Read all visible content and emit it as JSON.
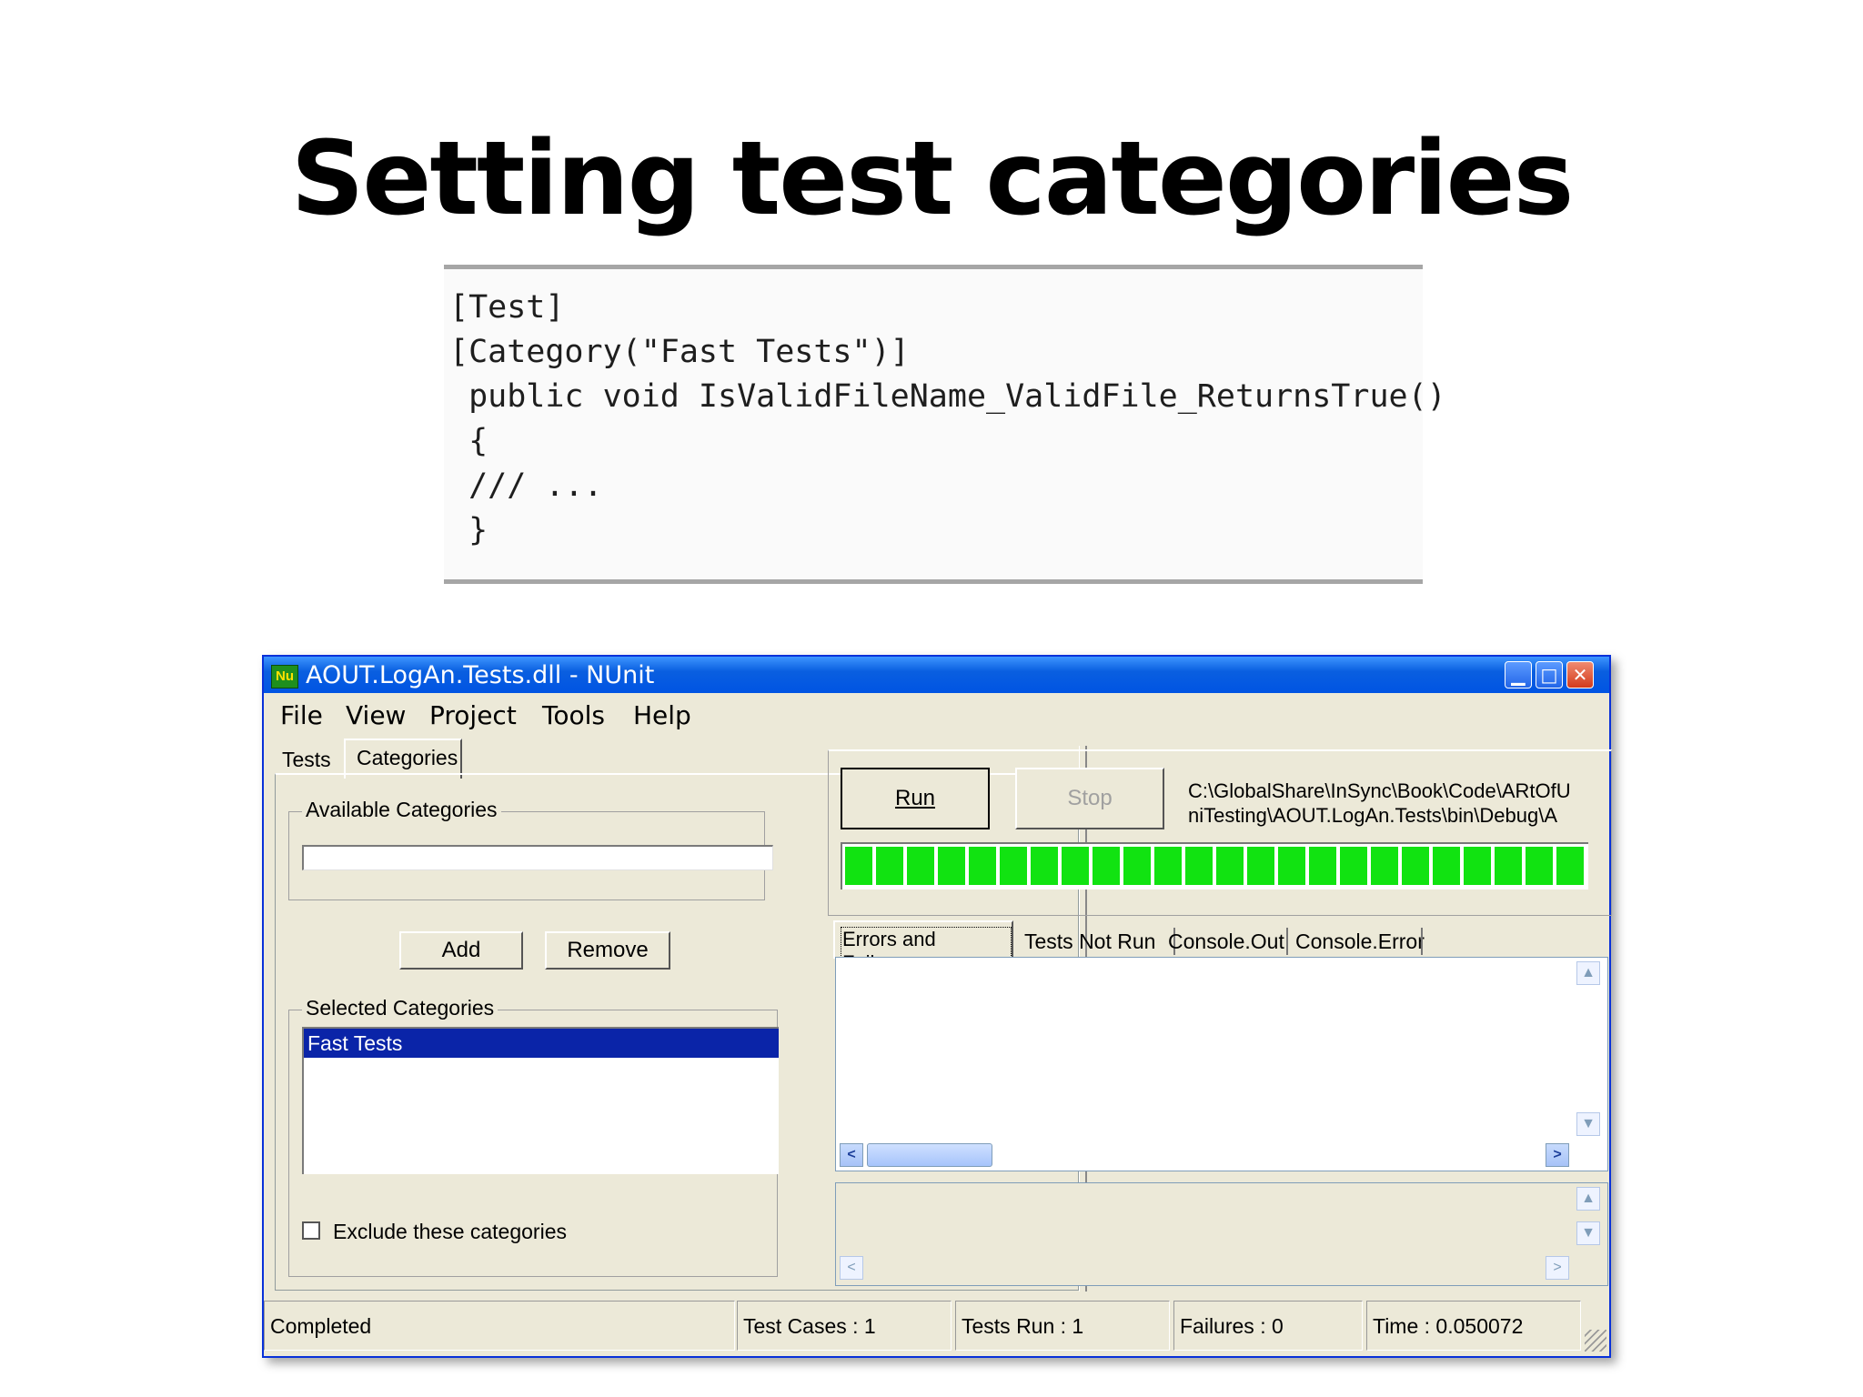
{
  "slide": {
    "title": "Setting test categories",
    "code_lines": [
      "[Test]",
      "[Category(\"Fast Tests\")]",
      " public void IsValidFileName_ValidFile_ReturnsTrue()",
      " {",
      " /// ...",
      " }"
    ]
  },
  "window": {
    "icon_text": "Nu",
    "title": "AOUT.LogAn.Tests.dll - NUnit",
    "caption_buttons": [
      "minimize-icon",
      "maximize-icon",
      "close-icon"
    ]
  },
  "menu": [
    "File",
    "View",
    "Project",
    "Tools",
    "Help"
  ],
  "left_tabs": [
    "Tests",
    "Categories"
  ],
  "categories": {
    "available_label": "Available Categories",
    "available_value": "",
    "add_label": "Add",
    "remove_label": "Remove",
    "selected_label": "Selected Categories",
    "selected_items": [
      "Fast Tests"
    ],
    "exclude_label": "Exclude these categories",
    "exclude_checked": false
  },
  "run": {
    "run_label": "Run",
    "stop_label": "Stop",
    "path_line1": "C:\\GlobalShare\\InSync\\Book\\Code\\ARtOfU",
    "path_line2": "niTesting\\AOUT.LogAn.Tests\\bin\\Debug\\A",
    "progress": 1.0,
    "progress_color": "#11e311"
  },
  "result_tabs": [
    "Errors and Failures",
    "Tests Not Run",
    "Console.Out",
    "Console.Error"
  ],
  "status": {
    "state": "Completed",
    "test_cases": "Test Cases : 1",
    "tests_run": "Tests Run : 1",
    "failures": "Failures : 0",
    "time": "Time : 0.050072"
  }
}
